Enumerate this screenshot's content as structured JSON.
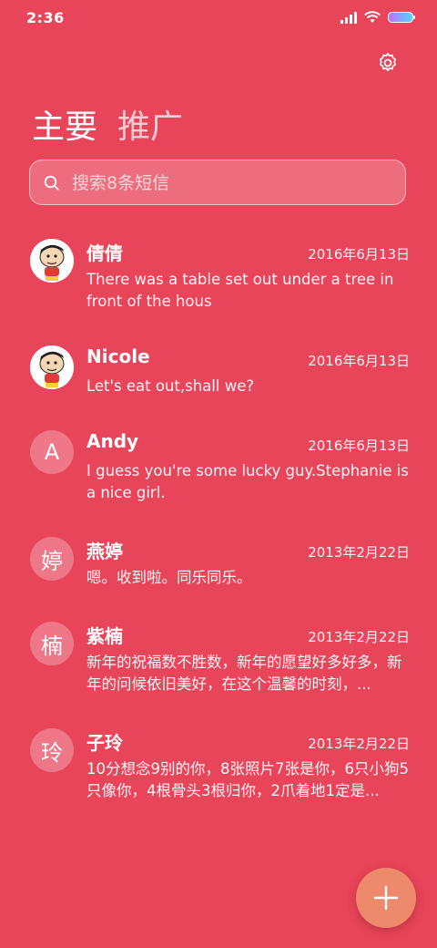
{
  "status_bar": {
    "time": "2:36"
  },
  "tabs": [
    {
      "label": "主要",
      "active": true
    },
    {
      "label": "推广",
      "active": false
    }
  ],
  "search": {
    "placeholder": "搜索8条短信"
  },
  "conversations": [
    {
      "name": "倩倩",
      "date": "2016年6月13日",
      "preview": "There was a table set out under a tree in front of the hous",
      "avatar": "cartoon-photo"
    },
    {
      "name": "Nicole",
      "date": "2016年6月13日",
      "preview": "Let's eat out,shall we?",
      "avatar": "cartoon-photo"
    },
    {
      "name": "Andy",
      "date": "2016年6月13日",
      "preview": "I guess you're some lucky guy.Stephanie is a nice girl.",
      "avatar_letter": "A"
    },
    {
      "name": "燕婷",
      "date": "2013年2月22日",
      "preview": "嗯。收到啦。同乐同乐。",
      "avatar_letter": "婷"
    },
    {
      "name": "紫楠",
      "date": "2013年2月22日",
      "preview": "新年的祝福数不胜数，新年的愿望好多好多，新年的问候依旧美好，在这个温馨的时刻，...",
      "avatar_letter": "楠"
    },
    {
      "name": "子玲",
      "date": "2013年2月22日",
      "preview": "10分想念9别的你，8张照片7张是你，6只小狗5只像你，4根骨头3根归你，2爪着地1定是...",
      "avatar_letter": "玲"
    }
  ],
  "colors": {
    "background": "#e8445a",
    "fab": "#ee8a6c"
  },
  "icons": {
    "settings": "gear-icon",
    "search": "search-icon",
    "compose": "plus-icon"
  }
}
